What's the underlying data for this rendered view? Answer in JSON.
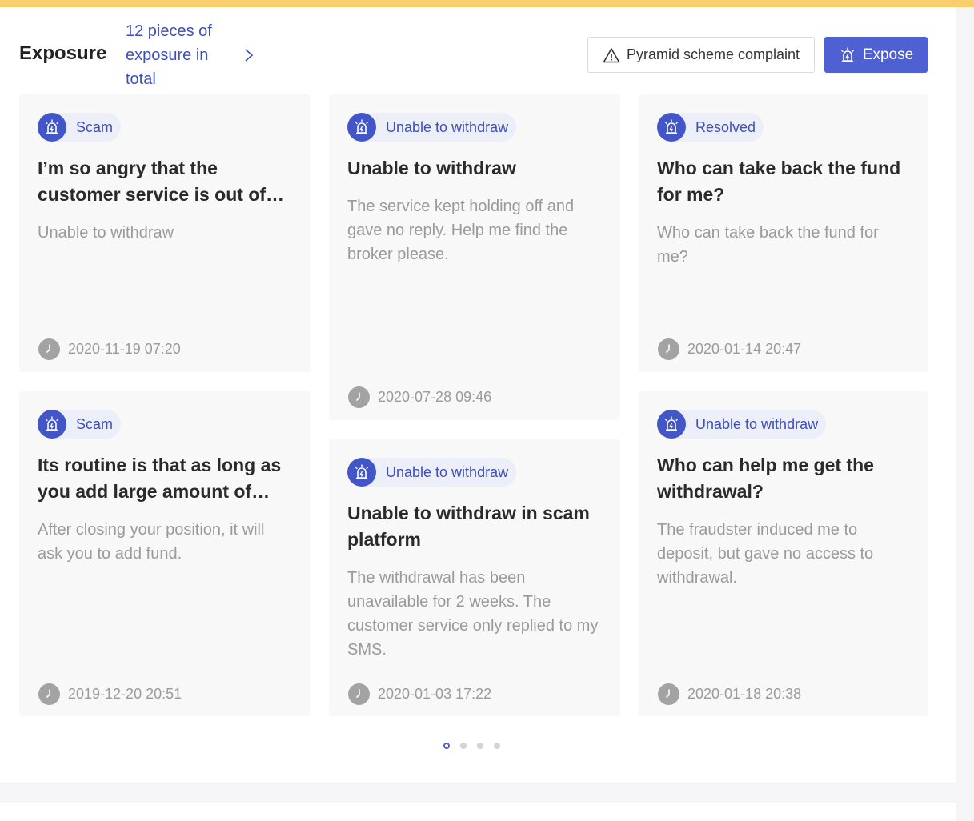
{
  "header": {
    "title": "Exposure",
    "count_text": "12 pieces of exposure in total",
    "complaint_button": "Pyramid scheme complaint",
    "expose_button": "Expose"
  },
  "cards": [
    {
      "tag": "Scam",
      "title": "I’m so angry that the customer service is out of touch",
      "desc": "Unable to withdraw",
      "date": "2020-11-19 07:20"
    },
    {
      "tag": "Unable to withdraw",
      "title": "Unable to withdraw",
      "desc": "The service kept holding off and gave no reply. Help me find the broker please.",
      "date": "2020-07-28 09:46"
    },
    {
      "tag": "Resolved",
      "title": "Who can take back the fund for me?",
      "desc": "Who can take back the fund for me?",
      "date": "2020-01-14 20:47"
    },
    {
      "tag": "Scam",
      "title": "Its routine is that as long as you add large amount of fund",
      "desc": "After closing your position, it will ask you to add fund.",
      "date": "2019-12-20 20:51"
    },
    {
      "tag": "Unable to withdraw",
      "title": "Unable to withdraw in scam platform",
      "desc": "The withdrawal has been unavailable for 2 weeks. The customer service only replied to my SMS.",
      "date": "2020-01-03 17:22"
    },
    {
      "tag": "Unable to withdraw",
      "title": "Who can help me get the withdrawal?",
      "desc": "The fraudster induced me to deposit, but gave no access to withdrawal.",
      "date": "2020-01-18 20:38"
    }
  ],
  "pagination": {
    "total_pages": 4,
    "active_page": 1
  },
  "colors": {
    "accent": "#4f60d3",
    "top_bar": "#f8cf6c",
    "tag_text": "#3d4fb8"
  }
}
